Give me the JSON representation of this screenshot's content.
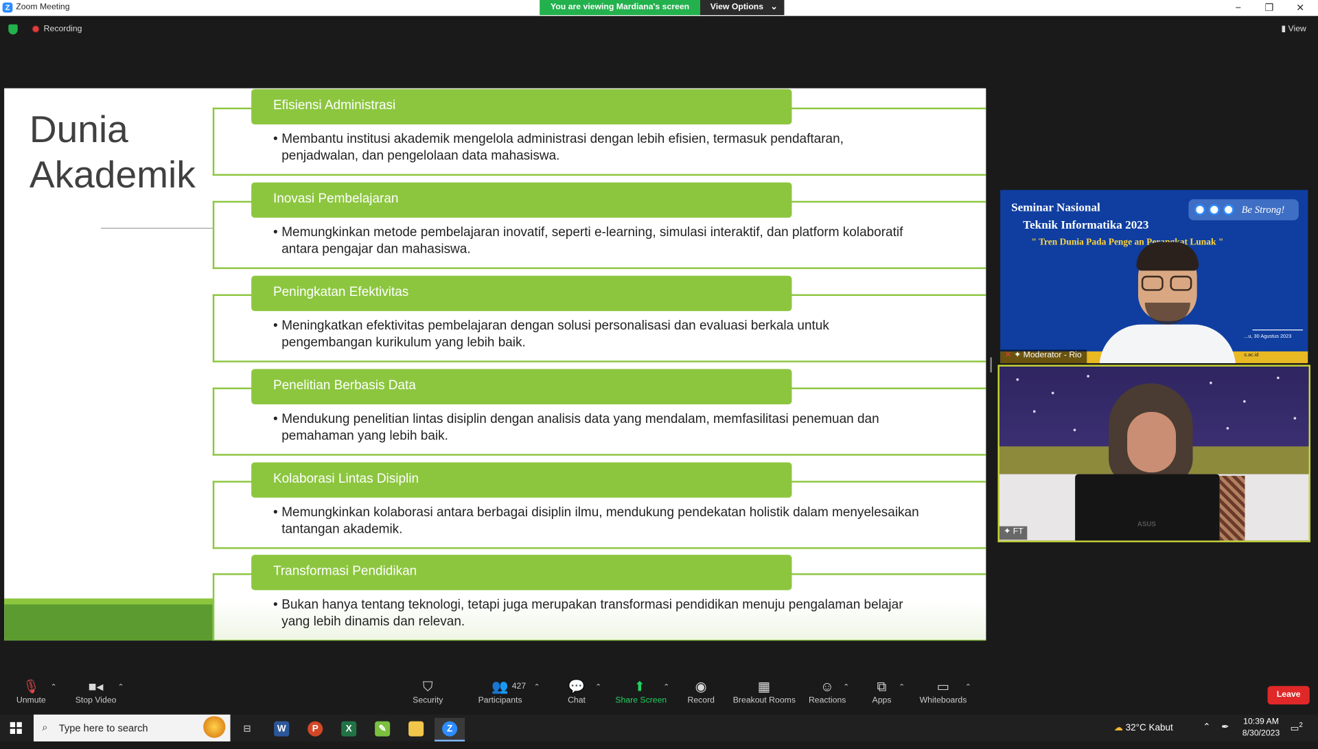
{
  "window": {
    "title": "Zoom Meeting",
    "viewing_banner": "You are viewing Mardiana's screen",
    "view_options": "View Options",
    "recording": "Recording",
    "view_label": "View"
  },
  "slide": {
    "title_line1": "Dunia",
    "title_line2": "Akademik",
    "items": [
      {
        "heading": "Efisiensi Administrasi",
        "text": "Membantu institusi akademik mengelola administrasi dengan lebih efisien, termasuk pendaftaran, penjadwalan, dan pengelolaan data mahasiswa."
      },
      {
        "heading": "Inovasi Pembelajaran",
        "text": "Memungkinkan metode pembelajaran inovatif, seperti e-learning, simulasi interaktif, dan platform kolaboratif antara pengajar dan mahasiswa."
      },
      {
        "heading": "Peningkatan Efektivitas",
        "text": "Meningkatkan efektivitas pembelajaran dengan solusi personalisasi dan evaluasi berkala untuk pengembangan kurikulum yang lebih baik."
      },
      {
        "heading": "Penelitian Berbasis Data",
        "text": "Mendukung penelitian lintas disiplin dengan analisis data yang mendalam, memfasilitasi penemuan dan pemahaman yang lebih baik."
      },
      {
        "heading": "Kolaborasi Lintas Disiplin",
        "text": "Memungkinkan kolaborasi antara berbagai disiplin ilmu, mendukung pendekatan holistik dalam menyelesaikan tantangan akademik."
      },
      {
        "heading": "Transformasi Pendidikan",
        "text": "Bukan hanya tentang teknologi, tetapi juga merupakan transformasi pendidikan menuju pengalaman belajar yang lebih dinamis dan relevan."
      }
    ],
    "accent_color": "#8cc63f"
  },
  "participants_panel": {
    "tile1": {
      "bg_line1": "Seminar Nasional",
      "bg_line2": "Teknik Informatika 2023",
      "bg_line3": "\" Tren Dunia Pada Penge        an Perangkat Lunak \"",
      "badge_text": "Be Strong!",
      "date_fragment": "...u, 30 Agustus 2023",
      "site_fragment": "s.ac.id",
      "name": "Moderator - Rio"
    },
    "tile2": {
      "name": "FT",
      "laptop_brand": "ASUS"
    }
  },
  "toolbar": {
    "unmute": "Unmute",
    "stop_video": "Stop Video",
    "security": "Security",
    "participants": "Participants",
    "participants_count": "427",
    "chat": "Chat",
    "share_screen": "Share Screen",
    "record": "Record",
    "breakout_rooms": "Breakout Rooms",
    "reactions": "Reactions",
    "apps": "Apps",
    "whiteboards": "Whiteboards",
    "leave": "Leave"
  },
  "taskbar": {
    "search_placeholder": "Type here to search",
    "weather": "32°C  Kabut",
    "time": "10:39 AM",
    "date": "8/30/2023",
    "notification_count": "2"
  },
  "icons": {
    "mic": "mic-muted-icon",
    "video": "video-camera-icon",
    "security": "shield-icon",
    "participants": "people-icon",
    "chat": "chat-bubble-icon",
    "share": "share-screen-icon",
    "record": "record-icon",
    "breakout": "grid-icon",
    "reactions": "smiley-icon",
    "apps": "apps-icon",
    "whiteboards": "whiteboard-icon"
  }
}
